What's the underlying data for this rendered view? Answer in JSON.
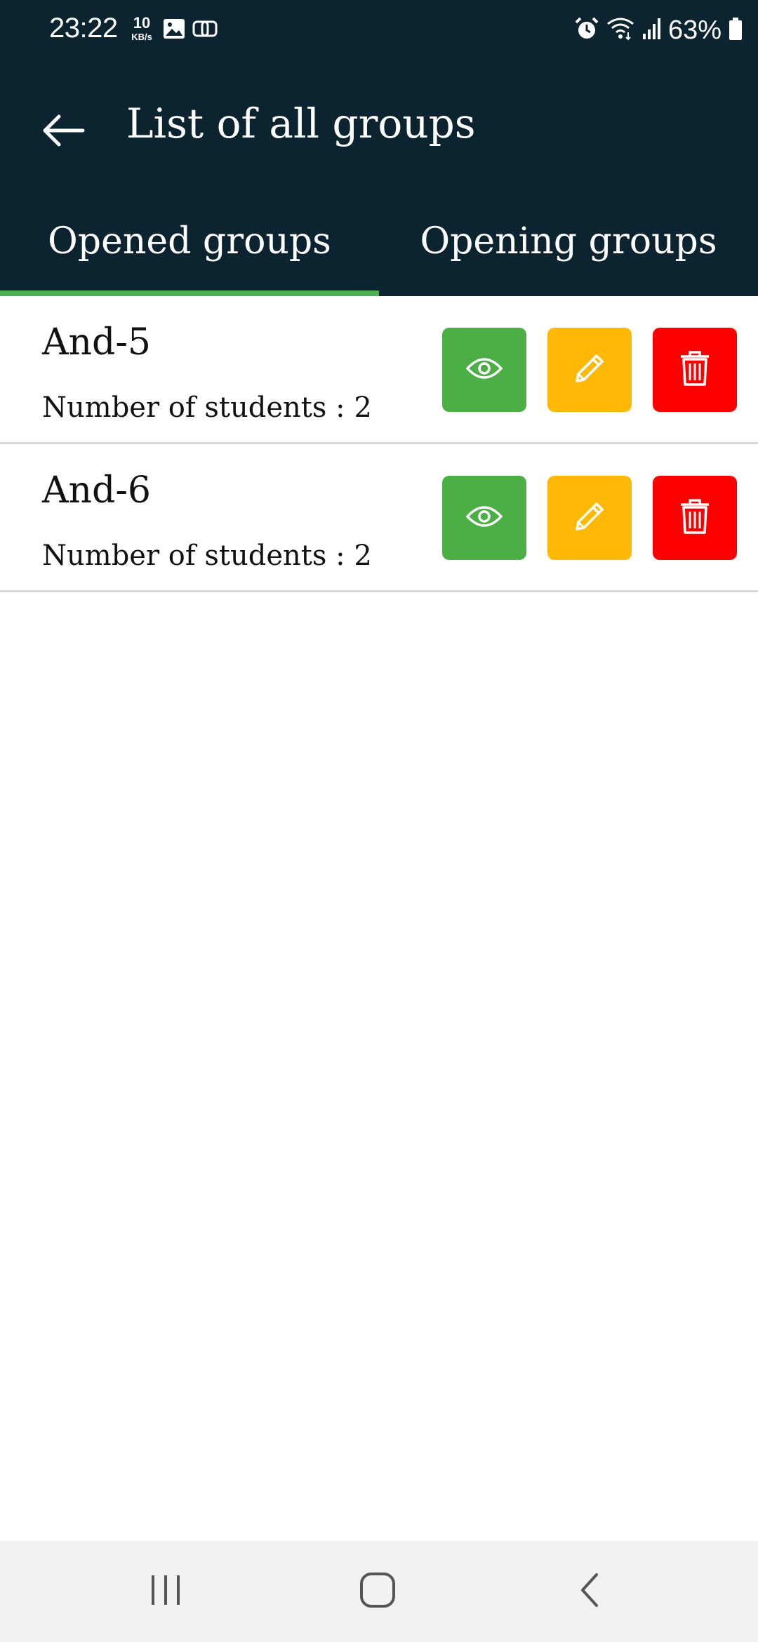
{
  "status_bar": {
    "time": "23:22",
    "speed_value": "10",
    "speed_unit": "KB/s",
    "battery_percent": "63%",
    "icons": [
      "image-icon",
      "link-icon",
      "alarm-icon",
      "wifi-icon",
      "signal-icon",
      "battery-icon"
    ]
  },
  "header": {
    "title": "List of all groups",
    "back_icon": "arrow-left-icon"
  },
  "tabs": [
    {
      "label": "Opened groups",
      "selected": true
    },
    {
      "label": "Opening groups",
      "selected": false
    }
  ],
  "groups": [
    {
      "name": "And-5",
      "students_label": "Number of students : 2"
    },
    {
      "name": "And-6",
      "students_label": "Number of students : 2"
    }
  ],
  "actions": {
    "view_icon": "eye-icon",
    "edit_icon": "pencil-icon",
    "delete_icon": "trash-icon"
  },
  "nav": {
    "recents_icon": "recents-icon",
    "home_icon": "home-icon",
    "back_icon": "back-chevron-icon"
  },
  "colors": {
    "header_bg": "#0c2330",
    "tab_indicator": "#4caf50",
    "view": "#4caf45",
    "edit": "#ffb805",
    "delete": "#fe0000",
    "nav_bg": "#f1f1f1"
  }
}
